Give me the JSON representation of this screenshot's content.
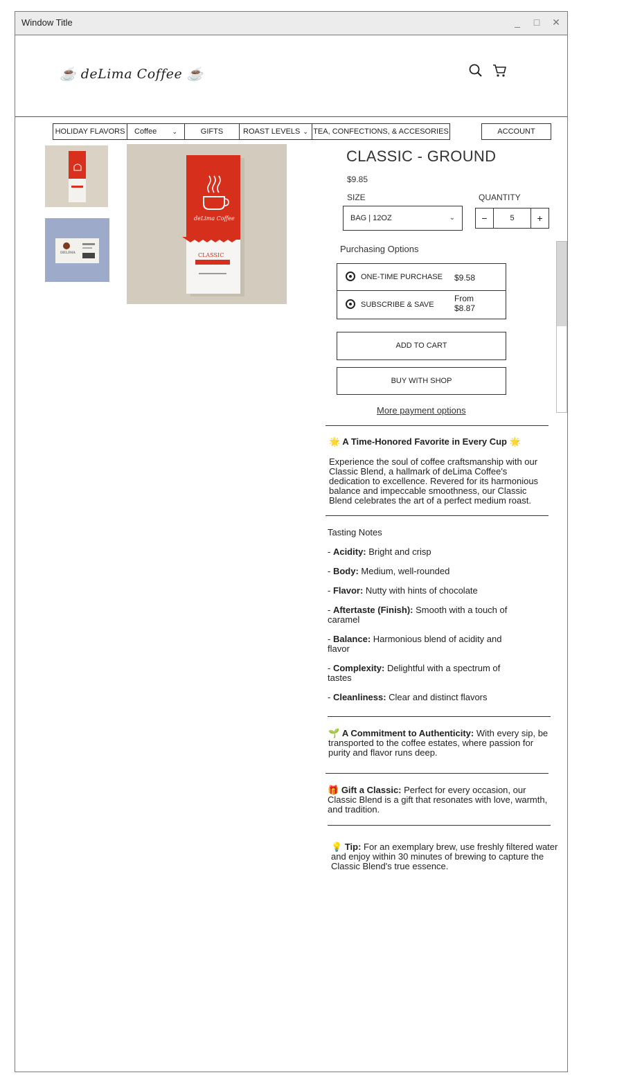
{
  "window": {
    "title": "Window Title",
    "controls": [
      "_",
      "□",
      "✕"
    ]
  },
  "header": {
    "logo": "☕ deLima Coffee ☕",
    "nav": [
      {
        "label": "HOLIDAY FLAVORS"
      },
      {
        "label": "Coffee",
        "dropdown": true
      },
      {
        "label": "GIFTS"
      },
      {
        "label": "ROAST LEVELS",
        "dropdown": true
      },
      {
        "label": "TEA, CONFECTIONS, & ACCESORIES"
      },
      {
        "label": "ACCOUNT"
      }
    ],
    "icons": [
      "search-icon",
      "cart-icon"
    ]
  },
  "product": {
    "title": "CLASSIC - GROUND",
    "price": "$9.85",
    "size_label": "SIZE",
    "size_value": "BAG | 12OZ",
    "quantity_label": "QUANTITY",
    "quantity": "5",
    "minus": "−",
    "plus": "+",
    "purchasing_label": "Purchasing Options",
    "options": [
      {
        "label": "ONE-TIME PURCHASE",
        "price": "$9.58"
      },
      {
        "label": "SUBSCRIBE & SAVE",
        "price_line1": "From",
        "price_line2": "$8.87"
      }
    ],
    "add_to_cart": "ADD TO CART",
    "buy_with_shop": "BUY WITH SHOP",
    "more_payment": "More payment options",
    "bag_brand": "deLima Coffee",
    "bag_label": "CLASSIC",
    "card_brand": "DELIMA"
  },
  "description": {
    "heading_prefix": "🌟 ",
    "heading": "A Time-Honored Favorite in Every Cup",
    "heading_suffix": " 🌟",
    "body": "Experience the soul of coffee craftsmanship with our Classic Blend, a hallmark of deLima Coffee's dedication to excellence. Revered for its harmonious balance and impeccable smoothness, our Classic Blend celebrates the art of a perfect medium roast.",
    "tasting_title": "Tasting Notes",
    "notes": [
      {
        "term": "Acidity:",
        "text": " Bright and crisp"
      },
      {
        "term": "Body:",
        "text": " Medium, well-rounded"
      },
      {
        "term": "Flavor:",
        "text": " Nutty with hints of chocolate"
      },
      {
        "term": "Aftertaste (Finish):",
        "text": " Smooth with a touch of caramel"
      },
      {
        "term": "Balance:",
        "text": " Harmonious blend of acidity and flavor"
      },
      {
        "term": "Complexity:",
        "text": " Delightful with a spectrum of tastes"
      },
      {
        "term": "Cleanliness:",
        "text": " Clear and distinct flavors"
      }
    ],
    "authenticity_icon": "🌱 ",
    "authenticity_term": "A Commitment to Authenticity:",
    "authenticity_text": " With every sip, be transported to the coffee estates, where passion for purity and flavor runs deep.",
    "gift_icon": "🎁 ",
    "gift_term": "Gift a Classic:",
    "gift_text": " Perfect for every occasion, our Classic Blend is a gift that resonates with love, warmth, and tradition.",
    "tip_icon": "💡 ",
    "tip_term": "Tip:",
    "tip_text": " For an exemplary brew, use freshly filtered water and enjoy within 30 minutes of brewing to capture the Classic Blend's true essence."
  }
}
